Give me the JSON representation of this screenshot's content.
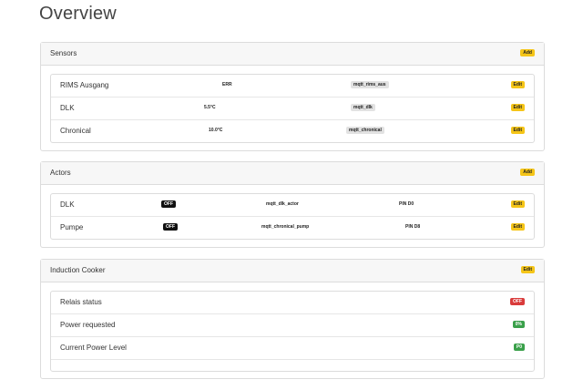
{
  "page": {
    "title": "Overview"
  },
  "sensors": {
    "title": "Sensors",
    "add_label": "Add",
    "rows": [
      {
        "name": "RIMS Ausgang",
        "value": "ERR",
        "topic": "mqtt_rims_aus",
        "edit_label": "Edit"
      },
      {
        "name": "DLK",
        "value": "5.5°C",
        "topic": "mqtt_dlk",
        "edit_label": "Edit"
      },
      {
        "name": "Chronical",
        "value": "10.0°C",
        "topic": "mqtt_chronical",
        "edit_label": "Edit"
      }
    ]
  },
  "actors": {
    "title": "Actors",
    "add_label": "Add",
    "rows": [
      {
        "name": "DLK",
        "state": "OFF",
        "topic": "mqtt_dlk_actor",
        "pin": "PIN D0",
        "edit_label": "Edit"
      },
      {
        "name": "Pumpe",
        "state": "OFF",
        "topic": "mqtt_chronical_pump",
        "pin": "PIN D8",
        "edit_label": "Edit"
      }
    ]
  },
  "induction": {
    "title": "Induction Cooker",
    "edit_label": "Edit",
    "rows": [
      {
        "label": "Relais status",
        "value": "OFF",
        "color": "#d93b3b"
      },
      {
        "label": "Power requested",
        "value": "0%",
        "color": "#3aa04a"
      },
      {
        "label": "Current Power Level",
        "value": "P0",
        "color": "#3aa04a"
      }
    ]
  }
}
